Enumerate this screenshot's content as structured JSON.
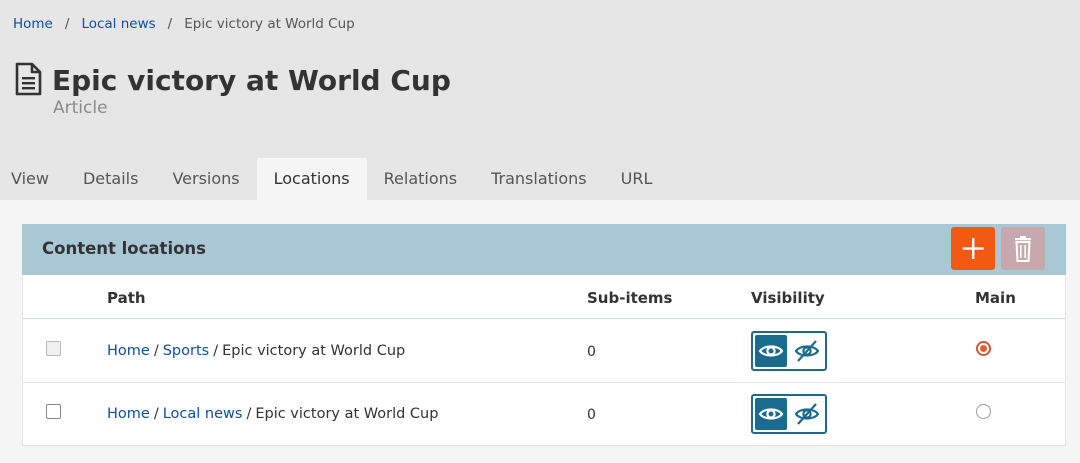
{
  "breadcrumb": {
    "items": [
      "Home",
      "Local news"
    ],
    "separator": "/",
    "current": "Epic victory at World Cup"
  },
  "header": {
    "icon": "document-icon",
    "title": "Epic victory at World Cup",
    "subtitle": "Article"
  },
  "tabs": [
    "View",
    "Details",
    "Versions",
    "Locations",
    "Relations",
    "Translations",
    "URL"
  ],
  "active_tab": "Locations",
  "panel": {
    "title": "Content locations",
    "add_icon": "plus-icon",
    "delete_icon": "trash-icon",
    "columns": {
      "path": "Path",
      "sub_items": "Sub-items",
      "visibility": "Visibility",
      "main": "Main"
    },
    "rows": [
      {
        "path": [
          "Home",
          "Sports"
        ],
        "name": "Epic victory at World Cup",
        "sub_items": "0",
        "main": true,
        "checkbox_disabled": true
      },
      {
        "path": [
          "Home",
          "Local news"
        ],
        "name": "Epic victory at World Cup",
        "sub_items": "0",
        "main": false,
        "checkbox_disabled": false
      }
    ],
    "separator": "/"
  },
  "colors": {
    "header_bg": "#e7e6e6",
    "panel_header_bg": "#a8c8d6",
    "accent_orange": "#f15a10",
    "link_blue": "#0b4fa3",
    "visibility_blue": "#1a6b8e"
  }
}
